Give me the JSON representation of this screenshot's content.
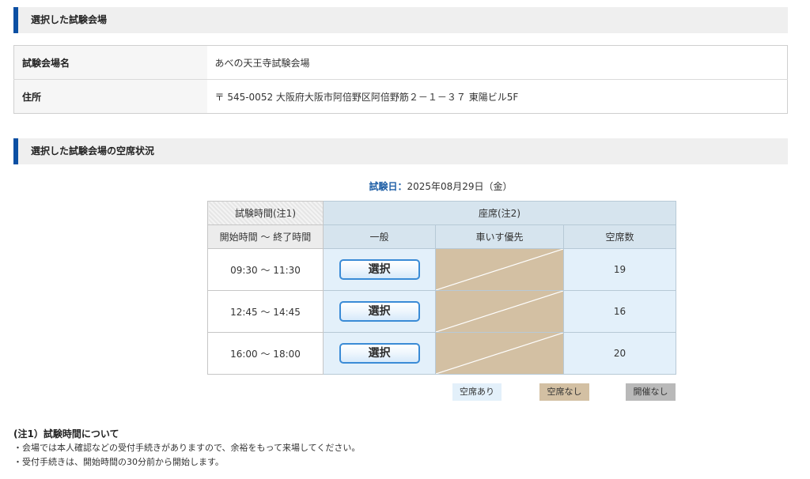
{
  "section_selected_venue": {
    "title": "選択した試験会場"
  },
  "venue": {
    "name_label": "試験会場名",
    "name_value": "あべの天王寺試験会場",
    "address_label": "住所",
    "address_value": "〒 545-0052 大阪府大阪市阿倍野区阿倍野筋２－１－３７ 東陽ビル5F"
  },
  "section_availability": {
    "title": "選択した試験会場の空席状況"
  },
  "exam_date": {
    "label": "試験日：",
    "value": "2025年08月29日（金）"
  },
  "seat_table": {
    "header_time": "試験時間(注1)",
    "header_seats": "座席(注2)",
    "subheader_time": "開始時間 ～ 終了時間",
    "subheader_general": "一般",
    "subheader_wheelchair": "車いす優先",
    "subheader_count": "空席数",
    "select_label": "選択",
    "rows": [
      {
        "time": "09:30 ～ 11:30",
        "count": "19"
      },
      {
        "time": "12:45 ～ 14:45",
        "count": "16"
      },
      {
        "time": "16:00 ～ 18:00",
        "count": "20"
      }
    ]
  },
  "legend": {
    "available": "空席あり",
    "full": "空席なし",
    "closed": "開催なし"
  },
  "colors": {
    "accent": "#0b4fa3",
    "available_bg": "#e3f0fa",
    "full_bg": "#d3c0a3",
    "closed_bg": "#b9b9b9"
  },
  "notes": {
    "title": "(注1）試験時間について",
    "line1": "・会場では本人確認などの受付手続きがありますので、余裕をもって来場してください。",
    "line2": "・受付手続きは、開始時間の30分前から開始します。"
  }
}
